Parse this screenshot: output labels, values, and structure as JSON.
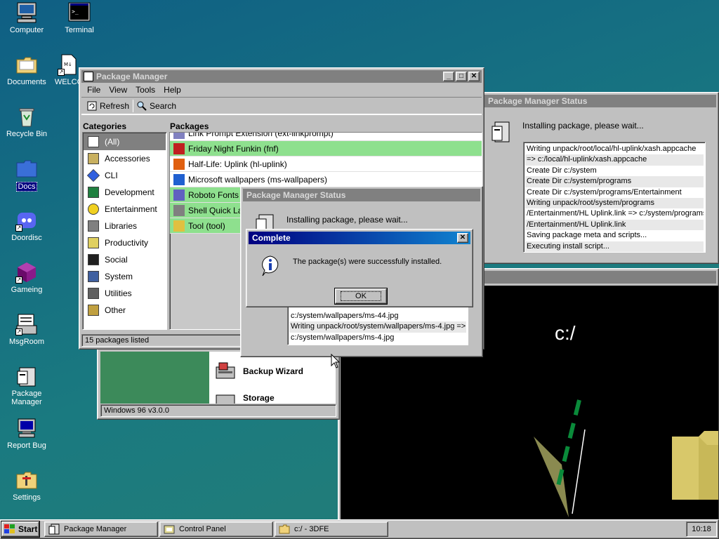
{
  "desktop": {
    "icons": [
      {
        "label": "Computer",
        "icon": "computer-icon"
      },
      {
        "label": "Terminal",
        "icon": "terminal-icon"
      },
      {
        "label": "Documents",
        "icon": "folder-icon"
      },
      {
        "label": "WELCO",
        "icon": "document-icon"
      },
      {
        "label": "Recycle Bin",
        "icon": "recycle-bin-icon"
      },
      {
        "label": "Docs",
        "icon": "folder-icon"
      },
      {
        "label": "Doordisc",
        "icon": "discord-icon"
      },
      {
        "label": "Gameing",
        "icon": "cube-icon"
      },
      {
        "label": "MsgRoom",
        "icon": "chat-icon"
      },
      {
        "label": "Package Manager",
        "icon": "package-icon"
      },
      {
        "label": "Report Bug",
        "icon": "bug-report-icon"
      },
      {
        "label": "Settings",
        "icon": "settings-icon"
      }
    ]
  },
  "package_manager": {
    "title": "Package Manager",
    "menu": [
      "File",
      "View",
      "Tools",
      "Help"
    ],
    "toolbar": {
      "refresh": "Refresh",
      "search": "Search"
    },
    "categories_header": "Categories",
    "packages_header": "Packages",
    "categories": [
      "(All)",
      "Accessories",
      "CLI",
      "Development",
      "Entertainment",
      "Libraries",
      "Productivity",
      "Social",
      "System",
      "Utilities",
      "Other"
    ],
    "packages": [
      {
        "name": "Link Prompt Extension (ext-linkprompt)",
        "highlight": false
      },
      {
        "name": "Friday Night Funkin (fnf)",
        "highlight": true
      },
      {
        "name": "Half-Life: Uplink (hl-uplink)",
        "highlight": false
      },
      {
        "name": "Microsoft wallpapers (ms-wallpapers)",
        "highlight": false
      },
      {
        "name": "Roboto Fonts (fonts-roboto)",
        "highlight": true
      },
      {
        "name": "Shell Quick Launch",
        "highlight": true
      },
      {
        "name": "Tool (tool)",
        "highlight": true
      }
    ],
    "status": "15 packages listed"
  },
  "status_back": {
    "title": "Package Manager Status",
    "message": "Installing package, please wait...",
    "log": [
      "Writing unpack/root/local/hl-uplink/xash.appcache",
      "=> c:/local/hl-uplink/xash.appcache",
      "Create Dir c:/system",
      "Create Dir c:/system/programs",
      "Create Dir c:/system/programs/Entertainment",
      "Writing unpack/root/system/programs",
      "/Entertainment/HL Uplink.link => c:/system/programs",
      "/Entertainment/HL Uplink.link",
      "Saving package meta and scripts...",
      "Executing install script..."
    ]
  },
  "status_front": {
    "title": "Package Manager Status",
    "message": "Installing package, please wait...",
    "log": [
      "c:/system/wallpapers/ms-44.jpg",
      "Writing unpack/root/system/wallpapers/ms-4.jpg =>",
      "c:/system/wallpapers/ms-4.jpg"
    ]
  },
  "complete_dialog": {
    "title": "Complete",
    "message": "The package(s) were successfully installed.",
    "ok": "OK"
  },
  "control_panel": {
    "items": [
      "Backup Wizard",
      "Storage"
    ],
    "version": "Windows 96 v3.0.0"
  },
  "explorer_3d": {
    "path": "c:/"
  },
  "taskbar": {
    "start": "Start",
    "tasks": [
      "Package Manager",
      "Control Panel",
      "c:/ - 3DFE"
    ],
    "clock": "10:18"
  },
  "colors": {
    "title_active": "#000080",
    "highlight_green": "#8ee08e",
    "face": "#c0c0c0"
  }
}
